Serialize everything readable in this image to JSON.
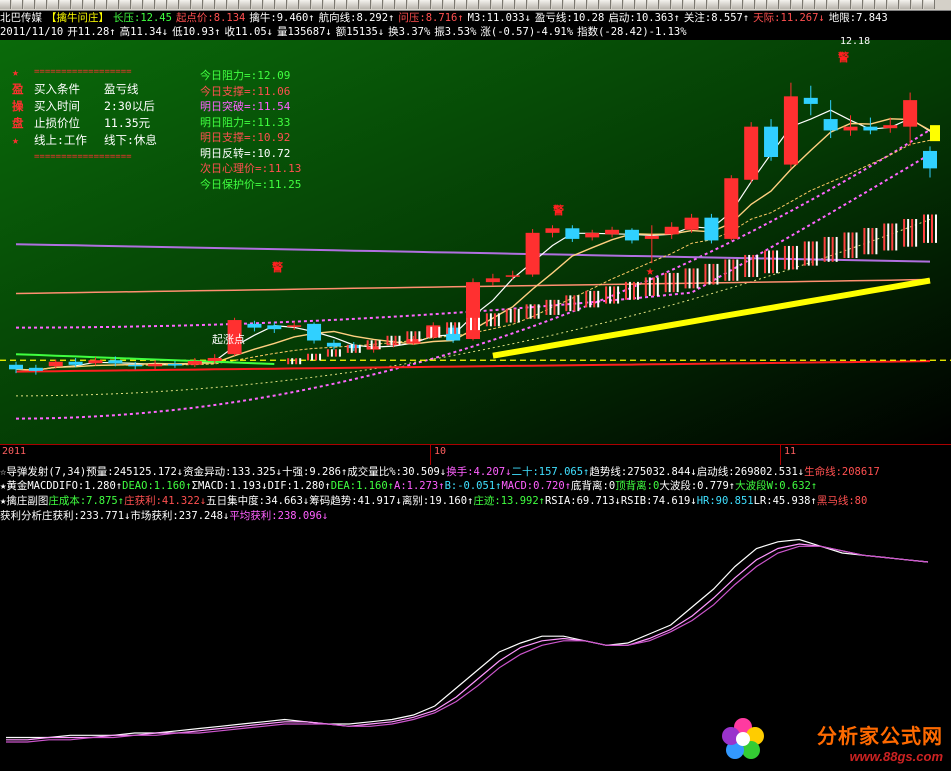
{
  "header": {
    "row1": [
      {
        "t": "北巴传媒",
        "c": "w"
      },
      {
        "t": "【擒牛问庄】",
        "c": "y"
      },
      {
        "t": "长压:12.45",
        "c": "g"
      },
      {
        "t": "起点价:8.134",
        "c": "r"
      },
      {
        "t": "擒牛:9.460↑",
        "c": "w"
      },
      {
        "t": "航向线:8.292↑",
        "c": "w"
      },
      {
        "t": "问压:8.716↑",
        "c": "r"
      },
      {
        "t": "M3:11.033↓",
        "c": "w"
      },
      {
        "t": "盈亏线:10.28",
        "c": "w"
      },
      {
        "t": "启动:10.363↑",
        "c": "w"
      },
      {
        "t": "关注:8.557↑",
        "c": "w"
      },
      {
        "t": "天际:11.267↓",
        "c": "r"
      },
      {
        "t": "地限:7.843",
        "c": "w"
      }
    ],
    "row2": [
      {
        "t": "2011/11/10",
        "c": "w"
      },
      {
        "t": "开11.28↑",
        "c": "w"
      },
      {
        "t": "高11.34↓",
        "c": "w"
      },
      {
        "t": "低10.93↑",
        "c": "w"
      },
      {
        "t": "收11.05↓",
        "c": "w"
      },
      {
        "t": "量135687↓",
        "c": "w"
      },
      {
        "t": "额15135↓",
        "c": "w"
      },
      {
        "t": "换3.37%",
        "c": "w"
      },
      {
        "t": "振3.53%",
        "c": "w"
      },
      {
        "t": "涨(-0.57)-4.91%",
        "c": "w"
      },
      {
        "t": "指数(-28.42)-1.13%",
        "c": "w"
      }
    ]
  },
  "info_box": {
    "stars": [
      "★",
      "盈",
      "操",
      "盘",
      "★"
    ],
    "sep": "==================",
    "lines": [
      {
        "k": "买入条件",
        "v": "盈亏线"
      },
      {
        "k": "买入时间",
        "v": "2:30以后"
      },
      {
        "k": "止损价位",
        "v": "11.35元"
      },
      {
        "k": "线上:工作",
        "v": "线下:休息"
      }
    ]
  },
  "levels": [
    {
      "t": "今日阻力=:12.09",
      "c": "g"
    },
    {
      "t": "今日支撑=:11.06",
      "c": "r"
    },
    {
      "t": "明日突破=:11.54",
      "c": "m"
    },
    {
      "t": "明日阻力=:11.33",
      "c": "g"
    },
    {
      "t": "明日支撑=:10.92",
      "c": "r"
    },
    {
      "t": "明日反转=:10.72",
      "c": "w"
    },
    {
      "t": "次日心理价=:11.13",
      "c": "r"
    },
    {
      "t": "今日保护价=:11.25",
      "c": "g"
    }
  ],
  "annotations": {
    "peak_price": "12.18",
    "start_label": "起涨点",
    "warn": "警"
  },
  "x_axis_labels": [
    "2011",
    "10",
    "11"
  ],
  "indicators": {
    "ind1": [
      {
        "t": "☆导弹发射(7,34)",
        "c": "w"
      },
      {
        "t": "预量:245125.172↓",
        "c": "w"
      },
      {
        "t": "资金异动:133.325↓",
        "c": "w"
      },
      {
        "t": "十强:9.286↑",
        "c": "w"
      },
      {
        "t": "成交量比%:30.509↓",
        "c": "w"
      },
      {
        "t": "换手:4.207↓",
        "c": "m"
      },
      {
        "t": "二十:157.065↑",
        "c": "c"
      },
      {
        "t": "趋势线:275032.844↓",
        "c": "w"
      },
      {
        "t": "启动线:269802.531↓",
        "c": "w"
      },
      {
        "t": "生命线:208617",
        "c": "r"
      }
    ],
    "ind2": [
      {
        "t": "★黄金MACD",
        "c": "w"
      },
      {
        "t": "DIFO:1.280↑",
        "c": "w"
      },
      {
        "t": "DEAO:1.160↑",
        "c": "g"
      },
      {
        "t": "ΣMACD:1.193↓",
        "c": "w"
      },
      {
        "t": "DIF:1.280↑",
        "c": "w"
      },
      {
        "t": "DEA:1.160↑",
        "c": "g"
      },
      {
        "t": "A:1.273↑",
        "c": "m"
      },
      {
        "t": "B:-0.051↑",
        "c": "c"
      },
      {
        "t": "MACD:0.720↑",
        "c": "m"
      },
      {
        "t": "底背离:0",
        "c": "w"
      },
      {
        "t": "顶背离:0",
        "c": "g"
      },
      {
        "t": "大波段:0.779↑",
        "c": "w"
      },
      {
        "t": "大波段W:0.632↑",
        "c": "g"
      }
    ],
    "ind3": [
      {
        "t": "★擒庄副图",
        "c": "w"
      },
      {
        "t": "庄成本:7.875↑",
        "c": "g"
      },
      {
        "t": "庄获利:41.322↓",
        "c": "r"
      },
      {
        "t": "五日集中度:34.663↓",
        "c": "w"
      },
      {
        "t": "筹码趋势:41.917↓",
        "c": "w"
      },
      {
        "t": "离别:19.160↑",
        "c": "w"
      },
      {
        "t": "庄迹:13.992↑",
        "c": "g"
      },
      {
        "t": "RSIA:69.713↓",
        "c": "w"
      },
      {
        "t": "RSIB:74.619↓",
        "c": "w"
      },
      {
        "t": "HR:90.851",
        "c": "c"
      },
      {
        "t": "LR:45.938↑",
        "c": "w"
      },
      {
        "t": "黑马线:80",
        "c": "r"
      }
    ],
    "ind4": [
      {
        "t": "获利分析",
        "c": "w"
      },
      {
        "t": "庄获利:233.771↓",
        "c": "w"
      },
      {
        "t": "市场获利:237.248↓",
        "c": "w"
      },
      {
        "t": "平均获利:238.096↓",
        "c": "m"
      }
    ]
  },
  "watermark": {
    "name": "分析家公式网",
    "url": "www.88gs.com"
  },
  "chart_data": {
    "type": "candlestick",
    "price_ylim": [
      7.6,
      12.4
    ],
    "candles": [
      {
        "o": 8.46,
        "c": 8.4,
        "h": 8.5,
        "l": 8.35
      },
      {
        "o": 8.42,
        "c": 8.38,
        "h": 8.46,
        "l": 8.33
      },
      {
        "o": 8.44,
        "c": 8.5,
        "h": 8.53,
        "l": 8.41
      },
      {
        "o": 8.5,
        "c": 8.46,
        "h": 8.55,
        "l": 8.43
      },
      {
        "o": 8.48,
        "c": 8.52,
        "h": 8.56,
        "l": 8.45
      },
      {
        "o": 8.52,
        "c": 8.48,
        "h": 8.57,
        "l": 8.44
      },
      {
        "o": 8.46,
        "c": 8.44,
        "h": 8.5,
        "l": 8.4
      },
      {
        "o": 8.44,
        "c": 8.47,
        "h": 8.52,
        "l": 8.4
      },
      {
        "o": 8.47,
        "c": 8.46,
        "h": 8.51,
        "l": 8.42
      },
      {
        "o": 8.46,
        "c": 8.51,
        "h": 8.55,
        "l": 8.43
      },
      {
        "o": 8.51,
        "c": 8.55,
        "h": 8.6,
        "l": 8.48
      },
      {
        "o": 8.6,
        "c": 9.05,
        "h": 9.08,
        "l": 8.58
      },
      {
        "o": 9.0,
        "c": 8.95,
        "h": 9.04,
        "l": 8.9
      },
      {
        "o": 8.98,
        "c": 8.93,
        "h": 9.02,
        "l": 8.88
      },
      {
        "o": 8.96,
        "c": 8.98,
        "h": 9.03,
        "l": 8.92
      },
      {
        "o": 9.0,
        "c": 8.78,
        "h": 9.02,
        "l": 8.74
      },
      {
        "o": 8.75,
        "c": 8.7,
        "h": 8.79,
        "l": 8.66
      },
      {
        "o": 8.72,
        "c": 8.68,
        "h": 8.76,
        "l": 8.64
      },
      {
        "o": 8.66,
        "c": 8.7,
        "h": 8.74,
        "l": 8.62
      },
      {
        "o": 8.72,
        "c": 8.74,
        "h": 8.78,
        "l": 8.69
      },
      {
        "o": 8.74,
        "c": 8.8,
        "h": 8.84,
        "l": 8.72
      },
      {
        "o": 8.82,
        "c": 8.98,
        "h": 9.02,
        "l": 8.8
      },
      {
        "o": 8.95,
        "c": 8.78,
        "h": 8.98,
        "l": 8.75
      },
      {
        "o": 8.8,
        "c": 9.55,
        "h": 9.6,
        "l": 8.78
      },
      {
        "o": 9.55,
        "c": 9.6,
        "h": 9.66,
        "l": 9.5
      },
      {
        "o": 9.62,
        "c": 9.64,
        "h": 9.7,
        "l": 9.58
      },
      {
        "o": 9.65,
        "c": 10.2,
        "h": 10.25,
        "l": 9.62
      },
      {
        "o": 10.2,
        "c": 10.26,
        "h": 10.3,
        "l": 10.14
      },
      {
        "o": 10.26,
        "c": 10.12,
        "h": 10.3,
        "l": 10.08
      },
      {
        "o": 10.14,
        "c": 10.2,
        "h": 10.24,
        "l": 10.1
      },
      {
        "o": 10.18,
        "c": 10.24,
        "h": 10.28,
        "l": 10.14
      },
      {
        "o": 10.24,
        "c": 10.1,
        "h": 10.26,
        "l": 10.06
      },
      {
        "o": 10.12,
        "c": 10.16,
        "h": 10.3,
        "l": 9.8
      },
      {
        "o": 10.18,
        "c": 10.28,
        "h": 10.34,
        "l": 10.12
      },
      {
        "o": 10.24,
        "c": 10.4,
        "h": 10.45,
        "l": 10.2
      },
      {
        "o": 10.4,
        "c": 10.1,
        "h": 10.45,
        "l": 10.06
      },
      {
        "o": 10.12,
        "c": 10.92,
        "h": 10.96,
        "l": 10.1
      },
      {
        "o": 10.9,
        "c": 11.6,
        "h": 11.66,
        "l": 10.86
      },
      {
        "o": 11.6,
        "c": 11.2,
        "h": 11.7,
        "l": 11.15
      },
      {
        "o": 11.1,
        "c": 12.0,
        "h": 12.18,
        "l": 11.05
      },
      {
        "o": 11.98,
        "c": 11.9,
        "h": 12.14,
        "l": 11.75
      },
      {
        "o": 11.7,
        "c": 11.55,
        "h": 11.95,
        "l": 11.45
      },
      {
        "o": 11.55,
        "c": 11.6,
        "h": 11.75,
        "l": 11.48
      },
      {
        "o": 11.6,
        "c": 11.55,
        "h": 11.72,
        "l": 11.5
      },
      {
        "o": 11.58,
        "c": 11.62,
        "h": 11.72,
        "l": 11.52
      },
      {
        "o": 11.6,
        "c": 11.95,
        "h": 12.05,
        "l": 11.35
      },
      {
        "o": 11.28,
        "c": 11.05,
        "h": 11.34,
        "l": 10.93
      }
    ],
    "profit_series": [
      {
        "name": "庄获利",
        "color": "#ffffff",
        "values": [
          0.1,
          0.1,
          0.1,
          0.11,
          0.11,
          0.11,
          0.12,
          0.12,
          0.13,
          0.14,
          0.15,
          0.16,
          0.17,
          0.18,
          0.17,
          0.16,
          0.16,
          0.17,
          0.18,
          0.2,
          0.24,
          0.32,
          0.4,
          0.48,
          0.52,
          0.55,
          0.55,
          0.53,
          0.51,
          0.52,
          0.56,
          0.6,
          0.68,
          0.76,
          0.86,
          0.94,
          0.97,
          0.98,
          0.95,
          0.92,
          0.91,
          0.9,
          0.89,
          0.88
        ]
      },
      {
        "name": "市场获利",
        "color": "#ff99ff",
        "values": [
          0.09,
          0.09,
          0.1,
          0.1,
          0.1,
          0.11,
          0.11,
          0.12,
          0.12,
          0.13,
          0.14,
          0.15,
          0.16,
          0.17,
          0.17,
          0.16,
          0.15,
          0.16,
          0.17,
          0.19,
          0.22,
          0.28,
          0.36,
          0.44,
          0.5,
          0.53,
          0.54,
          0.53,
          0.51,
          0.51,
          0.54,
          0.58,
          0.64,
          0.72,
          0.81,
          0.89,
          0.94,
          0.96,
          0.95,
          0.93,
          0.91,
          0.9,
          0.89,
          0.88
        ]
      },
      {
        "name": "平均获利",
        "color": "#cc55cc",
        "values": [
          0.08,
          0.08,
          0.09,
          0.09,
          0.1,
          0.1,
          0.11,
          0.11,
          0.12,
          0.12,
          0.13,
          0.14,
          0.15,
          0.16,
          0.16,
          0.16,
          0.15,
          0.15,
          0.16,
          0.18,
          0.21,
          0.26,
          0.33,
          0.41,
          0.47,
          0.51,
          0.53,
          0.53,
          0.51,
          0.51,
          0.53,
          0.57,
          0.62,
          0.69,
          0.78,
          0.86,
          0.92,
          0.95,
          0.95,
          0.93,
          0.91,
          0.9,
          0.89,
          0.88
        ]
      }
    ]
  },
  "colors": {
    "bull": "#ff3030",
    "bear": "#30d0ff",
    "bg_top": "#002a00",
    "bg_bottom": "#000000"
  }
}
